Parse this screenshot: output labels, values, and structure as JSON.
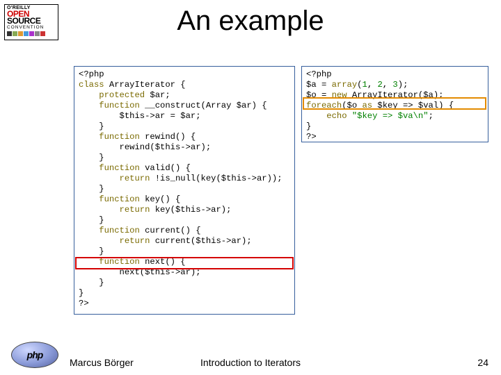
{
  "title": "An example",
  "logo": {
    "oreilly": "O'REILLY",
    "open": "OPEN",
    "source": "SOURCE",
    "convention": "CONVENTION",
    "php": "php"
  },
  "code_left": {
    "0": "<?php",
    "1a": "class ",
    "1b": "ArrayIterator {",
    "2a": "    ",
    "2b": "protected",
    "2c": " $ar;",
    "3a": "    ",
    "3b": "function",
    "3c": " __construct(Array $ar) {",
    "4": "        $this->ar = $ar;",
    "5": "    }",
    "6a": "    ",
    "6b": "function",
    "6c": " rewind() {",
    "7": "        rewind($this->ar);",
    "8": "    }",
    "9a": "    ",
    "9b": "function",
    "9c": " valid() {",
    "10a": "        ",
    "10b": "return",
    "10c": " !is_null(key($this->ar));",
    "11": "    }",
    "12a": "    ",
    "12b": "function",
    "12c": " key() {",
    "13a": "        ",
    "13b": "return",
    "13c": " key($this->ar);",
    "14": "    }",
    "15a": "    ",
    "15b": "function",
    "15c": " current() {",
    "16a": "        ",
    "16b": "return",
    "16c": " current($this->ar);",
    "17": "    }",
    "18a": "    ",
    "18b": "function",
    "18c": " next() {",
    "19": "        next($this->ar);",
    "20": "    }",
    "21": "}",
    "22": "?>"
  },
  "code_right": {
    "0": "<?php",
    "1a": "$a = ",
    "1b": "array",
    "1c": "(",
    "1d": "1",
    "1e": ", ",
    "1f": "2",
    "1g": ", ",
    "1h": "3",
    "1i": ");",
    "2a": "$o = ",
    "2b": "new",
    "2c": " ArrayIterator($a);",
    "3a": "foreach",
    "3b": "($o ",
    "3c": "as",
    "3d": " $key => $val) {",
    "4a": "    ",
    "4b": "echo",
    "4c": " ",
    "4d": "\"$key => $va\\n\"",
    "4e": ";",
    "5": "}",
    "6": "?>"
  },
  "footer": {
    "author": "Marcus Börger",
    "center": "Introduction to Iterators",
    "page": "24"
  }
}
